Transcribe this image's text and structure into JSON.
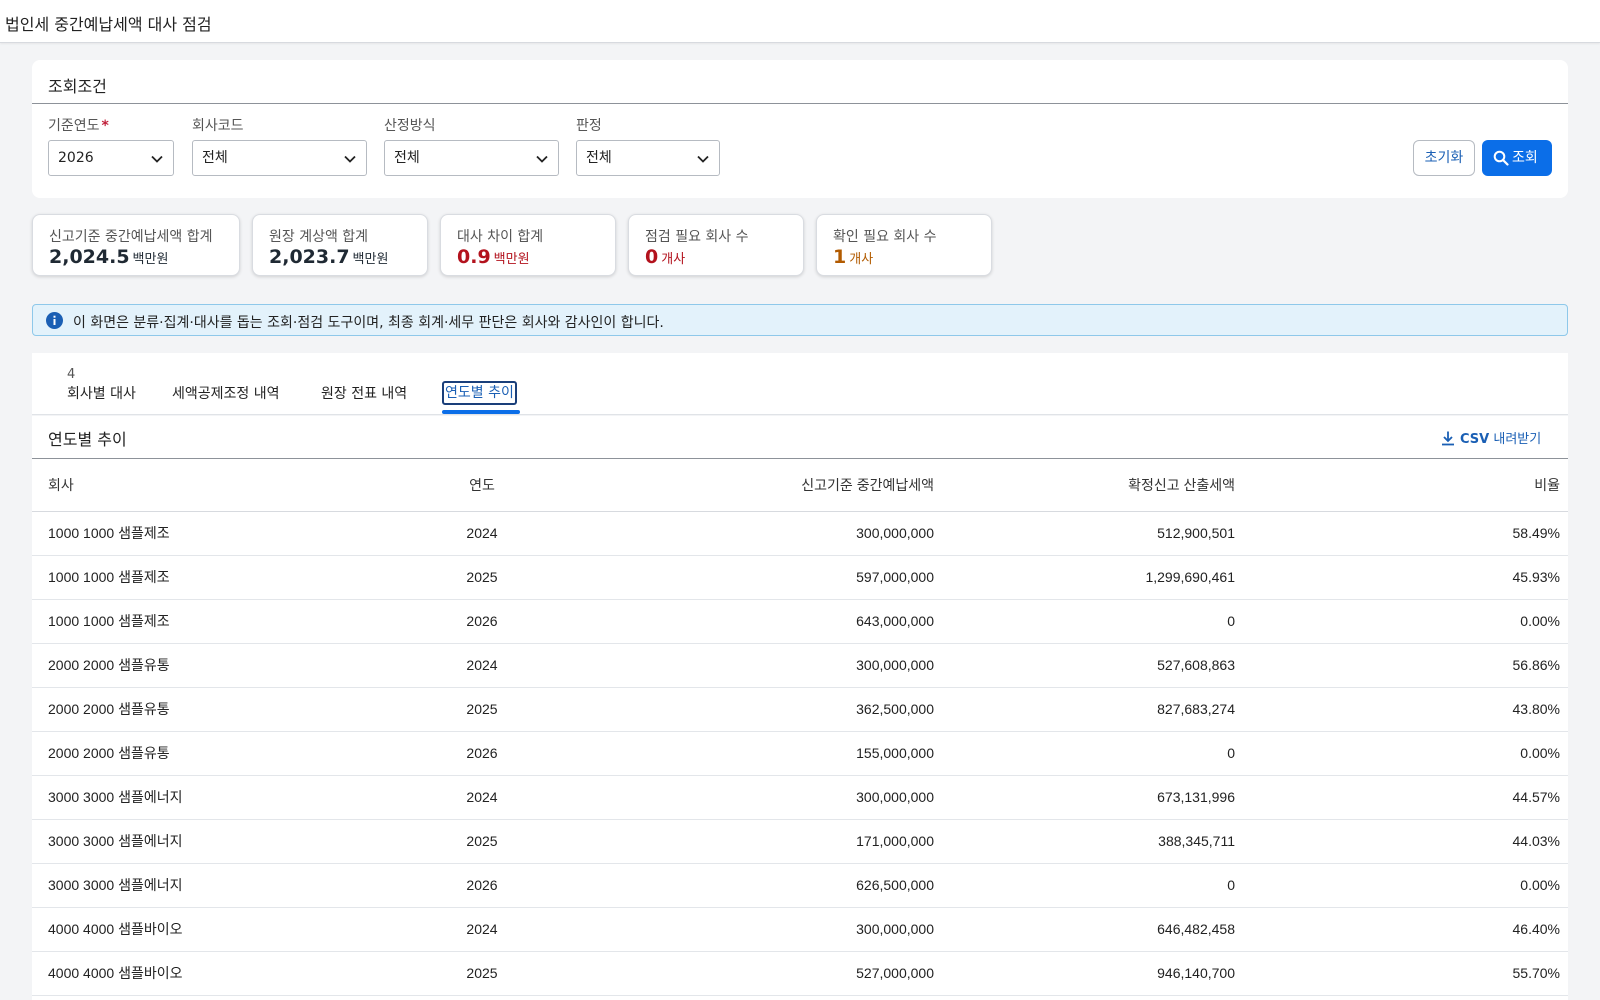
{
  "app": {
    "title": "법인세 중간예납세액 대사 점검"
  },
  "filters": {
    "title": "조회조건",
    "year": {
      "label": "기준연도",
      "required_mark": "*",
      "value": "2026"
    },
    "company": {
      "label": "회사코드",
      "value": "전체"
    },
    "method": {
      "label": "산정방식",
      "value": "전체"
    },
    "judgment": {
      "label": "판정",
      "value": "전체"
    },
    "reset_label": "초기화",
    "search_label": "조회"
  },
  "summary": [
    {
      "label": "신고기준 중간예납세액 합계",
      "value": "2,024.5",
      "unit": "백만원"
    },
    {
      "label": "원장 계상액 합계",
      "value": "2,023.7",
      "unit": "백만원"
    },
    {
      "label": "대사 차이 합계",
      "value": "0.9",
      "unit": "백만원"
    },
    {
      "label": "점검 필요 회사 수",
      "value": "0",
      "unit": "개사"
    },
    {
      "label": "확인 필요 회사 수",
      "value": "1",
      "unit": "개사"
    }
  ],
  "notice": {
    "text": "이 화면은 분류·집계·대사를 돕는 조회·점검 도구이며, 최종 회계·세무 판단은 회사와 감사인이 합니다."
  },
  "tabs": {
    "count": "4",
    "items": [
      {
        "label": "회사별 대사"
      },
      {
        "label": "세액공제조정 내역"
      },
      {
        "label": "원장 전표 내역"
      },
      {
        "label": "연도별 추이"
      }
    ],
    "active": "연도별 추이"
  },
  "section": {
    "title": "연도별 추이",
    "csv_label": "CSV",
    "csv_suffix": "내려받기"
  },
  "table": {
    "headers": [
      "회사",
      "연도",
      "신고기준 중간예납세액",
      "확정신고 산출세액",
      "비율"
    ],
    "rows": [
      [
        "1000 1000 샘플제조",
        "2024",
        "300,000,000",
        "512,900,501",
        "58.49%"
      ],
      [
        "1000 1000 샘플제조",
        "2025",
        "597,000,000",
        "1,299,690,461",
        "45.93%"
      ],
      [
        "1000 1000 샘플제조",
        "2026",
        "643,000,000",
        "0",
        "0.00%"
      ],
      [
        "2000 2000 샘플유통",
        "2024",
        "300,000,000",
        "527,608,863",
        "56.86%"
      ],
      [
        "2000 2000 샘플유통",
        "2025",
        "362,500,000",
        "827,683,274",
        "43.80%"
      ],
      [
        "2000 2000 샘플유통",
        "2026",
        "155,000,000",
        "0",
        "0.00%"
      ],
      [
        "3000 3000 샘플에너지",
        "2024",
        "300,000,000",
        "673,131,996",
        "44.57%"
      ],
      [
        "3000 3000 샘플에너지",
        "2025",
        "171,000,000",
        "388,345,711",
        "44.03%"
      ],
      [
        "3000 3000 샘플에너지",
        "2026",
        "626,500,000",
        "0",
        "0.00%"
      ],
      [
        "4000 4000 샘플바이오",
        "2024",
        "300,000,000",
        "646,482,458",
        "46.40%"
      ],
      [
        "4000 4000 샘플바이오",
        "2025",
        "527,000,000",
        "946,140,700",
        "55.70%"
      ]
    ]
  },
  "colors": {
    "primary": "#0b6ee8",
    "danger": "#b3121d",
    "warning": "#b25b00",
    "notice_bg": "#e3f2fb"
  }
}
